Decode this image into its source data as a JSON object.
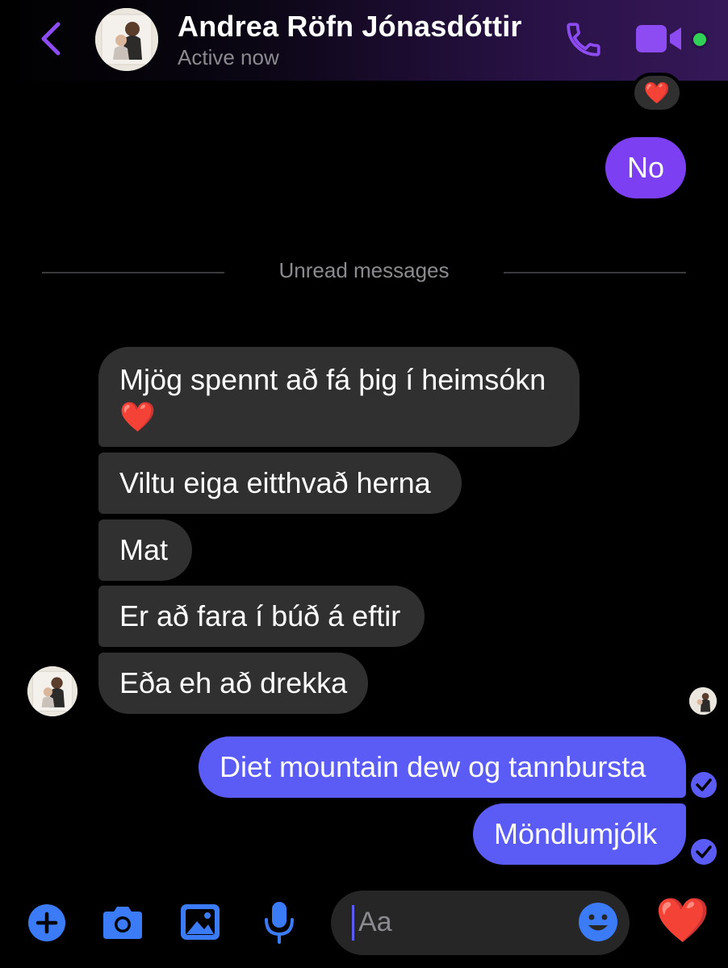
{
  "header": {
    "contact_name": "Andrea Röfn Jónasdóttir",
    "status": "Active now",
    "icons": [
      "chevron-left-icon",
      "phone-icon",
      "video-camera-icon"
    ],
    "online": true
  },
  "reaction": {
    "emoji": "❤️"
  },
  "messages": [
    {
      "direction": "outgoing",
      "text": "No"
    },
    {
      "direction": "incoming",
      "text": "Mjög spennt að fá þig í heimsókn ❤️"
    },
    {
      "direction": "incoming",
      "text": "Viltu eiga eitthvað herna"
    },
    {
      "direction": "incoming",
      "text": "Mat"
    },
    {
      "direction": "incoming",
      "text": "Er að fara í búð á eftir"
    },
    {
      "direction": "incoming",
      "text": "Eða eh að drekka"
    },
    {
      "direction": "outgoing",
      "text": "Diet mountain dew og tannbursta"
    },
    {
      "direction": "outgoing",
      "text": "Möndlumjólk"
    }
  ],
  "divider": {
    "label": "Unread messages"
  },
  "composer": {
    "placeholder": "Aa",
    "icons": [
      "plus-icon",
      "camera-icon",
      "image-icon",
      "microphone-icon",
      "emoji-icon"
    ],
    "like_emoji": "❤️"
  },
  "colors": {
    "accent_purple": "#7c3ff2",
    "outgoing_bubble": "#5a5cf5",
    "incoming_bubble": "#303030",
    "composer_icons": "#3b7bf6",
    "online_green": "#31d158"
  }
}
